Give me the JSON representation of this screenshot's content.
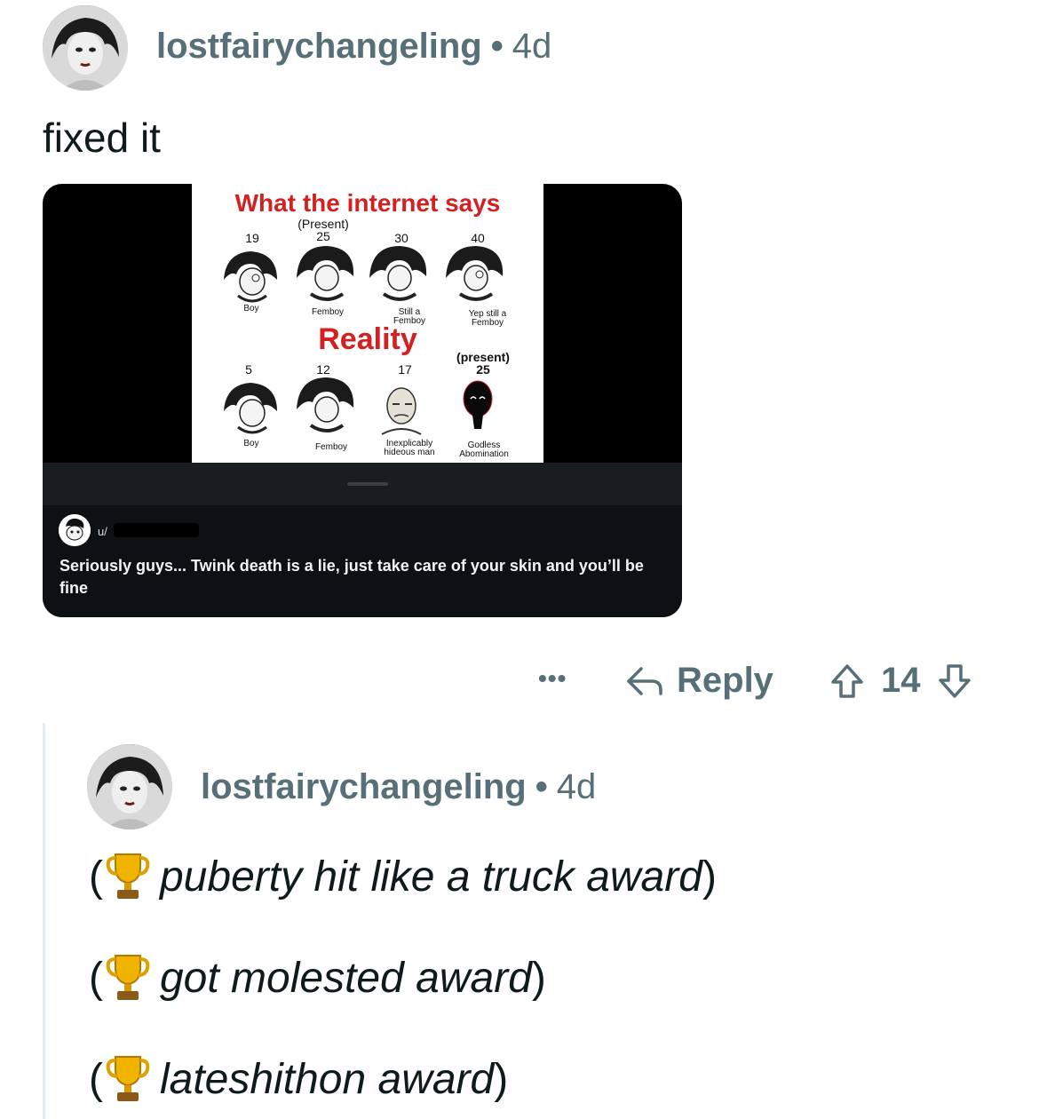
{
  "comment1": {
    "author": "lostfairychangeling",
    "separator": "•",
    "age": "4d",
    "body": "fixed it",
    "media": {
      "meme_title_top": "What the internet says",
      "meme_title_bottom": "Reality",
      "top_row": [
        {
          "age": "19",
          "label": "Boy"
        },
        {
          "age": "(Present)\n25",
          "label": "Femboy"
        },
        {
          "age": "30",
          "label": "Still a\nFemboy"
        },
        {
          "age": "40",
          "label": "Yep still a\nFemboy"
        }
      ],
      "bottom_row": [
        {
          "age": "5",
          "label": "Boy"
        },
        {
          "age": "12",
          "label": "Femboy"
        },
        {
          "age": "17",
          "label": "Inexplicably\nhideous man"
        },
        {
          "age": "(present)\n25",
          "label": "Godless\nAbomination"
        }
      ],
      "overlay_user": "u/",
      "overlay_caption": "Seriously guys... Twink death is a lie, just take care of your skin and you’ll be fine"
    },
    "actions": {
      "more_label": "•••",
      "reply_label": "Reply",
      "score": "14"
    }
  },
  "comment2": {
    "author": "lostfairychangeling",
    "separator": "•",
    "age": "4d",
    "awards": [
      {
        "open": "(",
        "text": "puberty hit like a truck award",
        "close": ")"
      },
      {
        "open": "(",
        "text": "got molested award",
        "close": ")"
      },
      {
        "open": "(",
        "text": "lateshithon award",
        "close": ")"
      }
    ]
  },
  "icons": {
    "reply": "reply-arrow-icon",
    "upvote": "upvote-arrow-icon",
    "downvote": "downvote-arrow-icon",
    "trophy": "trophy-emoji-icon"
  }
}
